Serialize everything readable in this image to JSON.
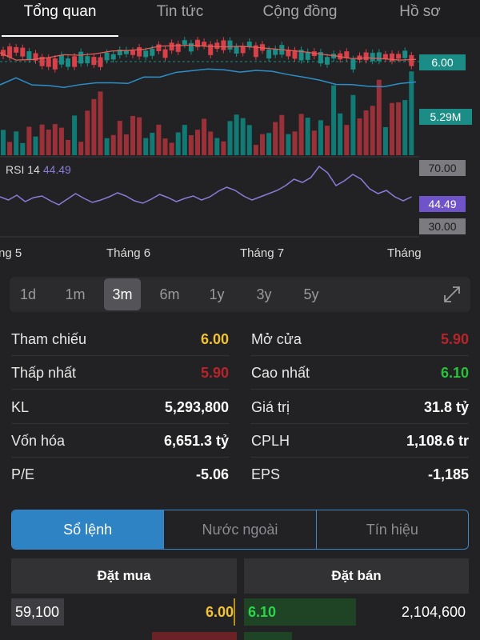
{
  "tabs": [
    "Tổng quan",
    "Tin tức",
    "Cộng đồng",
    "Hồ sơ"
  ],
  "chart": {
    "price_tag": "6.00",
    "volume_tag": "5.29M",
    "rsi_label": "RSI 14",
    "rsi_value": "44.49",
    "rsi_upper": "70.00",
    "rsi_lower": "30.00",
    "rsi_current": "44.49",
    "x_labels": [
      "ng 5",
      "Tháng 6",
      "Tháng 7",
      "Tháng"
    ],
    "colors": {
      "up": "#1b8d86",
      "down": "#d8404a",
      "rsi": "#8c7bd8",
      "band": "#2c8fc9"
    }
  },
  "ranges": [
    "1d",
    "1m",
    "3m",
    "6m",
    "1y",
    "3y",
    "5y"
  ],
  "active_range": "3m",
  "stats_left": [
    {
      "label": "Tham chiếu",
      "value": "6.00"
    },
    {
      "label": "Thấp nhất",
      "value": "5.90"
    },
    {
      "label": "KL",
      "value": "5,293,800"
    },
    {
      "label": "Vốn hóa",
      "value": "6,651.3 tỷ"
    },
    {
      "label": "P/E",
      "value": "-5.06"
    }
  ],
  "stats_right": [
    {
      "label": "Mở cửa",
      "value": "5.90"
    },
    {
      "label": "Cao nhất",
      "value": "6.10"
    },
    {
      "label": "Giá trị",
      "value": "31.8 tỷ"
    },
    {
      "label": "CPLH",
      "value": "1,108.6 tr"
    },
    {
      "label": "EPS",
      "value": "-1,185"
    }
  ],
  "segments": [
    "Sổ lệnh",
    "Nước ngoài",
    "Tín hiệu"
  ],
  "orderbook": {
    "buy_header": "Đặt mua",
    "sell_header": "Đặt bán",
    "bid_volume": "59,100",
    "bid_price": "6.00",
    "ask_price": "6.10",
    "ask_volume": "2,104,600"
  }
}
